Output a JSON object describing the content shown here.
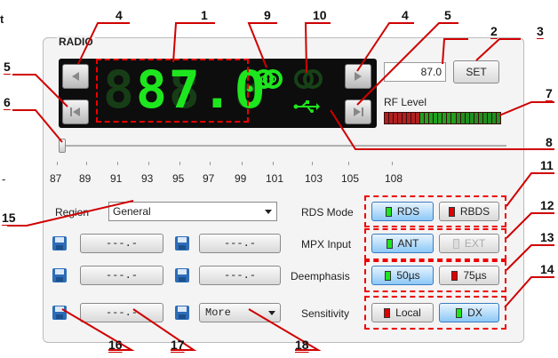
{
  "fragments": {
    "top": "t",
    "mid": "-"
  },
  "panel": {
    "title": "RADIO"
  },
  "display": {
    "frequency": "87.0",
    "ghost": "888.8",
    "stereo_icon": "stereo-rings-icon",
    "rds_icon": "rds-signal-icon",
    "usb_icon": "usb-icon"
  },
  "controls": {
    "freq_input": "87.0",
    "set_label": "SET",
    "rf_label": "RF Level",
    "rf_level": 0.6,
    "slider_value": 87.0,
    "scale": [
      "87",
      "89",
      "91",
      "93",
      "95",
      "97",
      "99",
      "101",
      "103",
      "105",
      "108"
    ]
  },
  "region": {
    "label": "Region",
    "value": "General"
  },
  "rds_mode": {
    "label": "RDS Mode",
    "options": [
      "RDS",
      "RBDS"
    ]
  },
  "mpx_input": {
    "label": "MPX Input",
    "options": [
      "ANT",
      "EXT"
    ]
  },
  "deemphasis": {
    "label": "Deemphasis",
    "options": [
      "50µs",
      "75µs"
    ]
  },
  "sensitivity": {
    "label": "Sensitivity",
    "options": [
      "Local",
      "DX"
    ]
  },
  "presets": {
    "empty": "---.-",
    "more": "More"
  },
  "callouts": [
    "1",
    "2",
    "3",
    "4",
    "4",
    "5",
    "5",
    "6",
    "7",
    "8",
    "9",
    "10",
    "11",
    "12",
    "13",
    "14",
    "15",
    "16",
    "17",
    "18"
  ],
  "colors": {
    "led_green": "#1ee61e",
    "callout_red": "#e00000",
    "toggle_blue": "#8cc8f6"
  }
}
